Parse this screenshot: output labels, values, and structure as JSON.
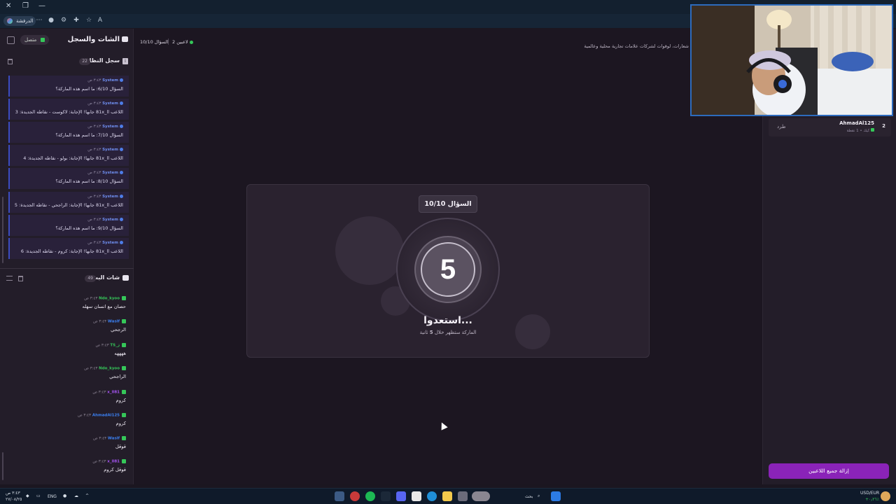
{
  "browser": {
    "profile_label": "الدرفشة"
  },
  "left_panel": {
    "title": "الشات والسجل",
    "status_label": "متصل",
    "system_log": {
      "title": "سجل النظام",
      "count": "22",
      "entries": [
        {
          "sender": "System",
          "time": "٣:٤٣ ص",
          "text": "السؤال 6/10: ما اسم هذه الماركة؟"
        },
        {
          "sender": "System",
          "time": "٣:٤٣ ص",
          "text": "اللاعب 81x_ll جابها! الإجابة: لاكوست - نقاطه الجديدة: 3"
        },
        {
          "sender": "System",
          "time": "٣:٤٣ ص",
          "text": "السؤال 7/10: ما اسم هذه الماركة؟"
        },
        {
          "sender": "System",
          "time": "٣:٤٣ ص",
          "text": "اللاعب 81x_ll جابها! الإجابة: بولو - نقاطه الجديدة: 4"
        },
        {
          "sender": "System",
          "time": "٣:٤٣ ص",
          "text": "السؤال 8/10: ما اسم هذه الماركة؟"
        },
        {
          "sender": "System",
          "time": "٣:٤٣ ص",
          "text": "اللاعب 81x_ll جابها! الإجابة: الراجحي - نقاطه الجديدة: 5"
        },
        {
          "sender": "System",
          "time": "٣:٤٣ ص",
          "text": "السؤال 9/10: ما اسم هذه الماركة؟"
        },
        {
          "sender": "System",
          "time": "٣:٤٣ ص",
          "text": "اللاعب 81x_ll جابها! الإجابة: كروم - نقاطه الجديدة: 6"
        }
      ]
    },
    "stream_chat": {
      "title": "شات البث",
      "count": "49",
      "messages": [
        {
          "user": "Ndo_kyoo",
          "time": "٣:٤٣ ص",
          "text": "حصان مع انسان سهله",
          "color": "#35c759"
        },
        {
          "user": "Waslf",
          "time": "٣:٤٣ ص",
          "text": "الرجحي",
          "color": "#3b82f6"
        },
        {
          "user": "TS_ز",
          "time": "٣:٤٣ ص",
          "text": "ههههه",
          "color": "#35c759"
        },
        {
          "user": "Ndo_kyoo",
          "time": "٣:٤٣ ص",
          "text": "الراجحي",
          "color": "#35c759"
        },
        {
          "user": "x_ll81",
          "time": "٣:٤٣ ص",
          "text": "كروم",
          "color": "#a855f7"
        },
        {
          "user": "AhmadAl125",
          "time": "٣:٤٣ ص",
          "text": "كروم",
          "color": "#3b82f6"
        },
        {
          "user": "Waslf",
          "time": "٣:٤٣ ص",
          "text": "قوقل",
          "color": "#3b82f6"
        },
        {
          "user": "x_ll81",
          "time": "٣:٤٣ ص",
          "text": "قوقل كروم",
          "color": "#a855f7"
        }
      ]
    }
  },
  "main": {
    "question_label": "السؤال 10/10",
    "players_count": "2 لاعبين",
    "subtitle": "شعارات، لوقوات لشركات علامات تجارية محلية وعالمية",
    "card": {
      "badge": "السؤال 10/10",
      "countdown": "5",
      "title": "استعدوا...",
      "subtitle_prefix": "الماركة ستظهر خلال",
      "subtitle_num": "5",
      "subtitle_suffix": "ثانية"
    }
  },
  "right_panel": {
    "player": {
      "name": "AhmadAl125",
      "meta": "كيك • 1 نقطة",
      "rank": "2",
      "kick_label": "طرد"
    },
    "remove_all_label": "إزالة جميع اللاعبين"
  },
  "taskbar": {
    "lang": "ENG",
    "time": "٣:٤٣ ص",
    "date": "٢٧/٠٨/٢٥",
    "currency": "USD/EUR",
    "currency_change": "+٠٫٢٦٪",
    "search_label": "بحث"
  },
  "colors": {
    "accent_purple": "#8a23b8",
    "kick_green": "#35c759",
    "system_blue": "#4d7de8"
  }
}
